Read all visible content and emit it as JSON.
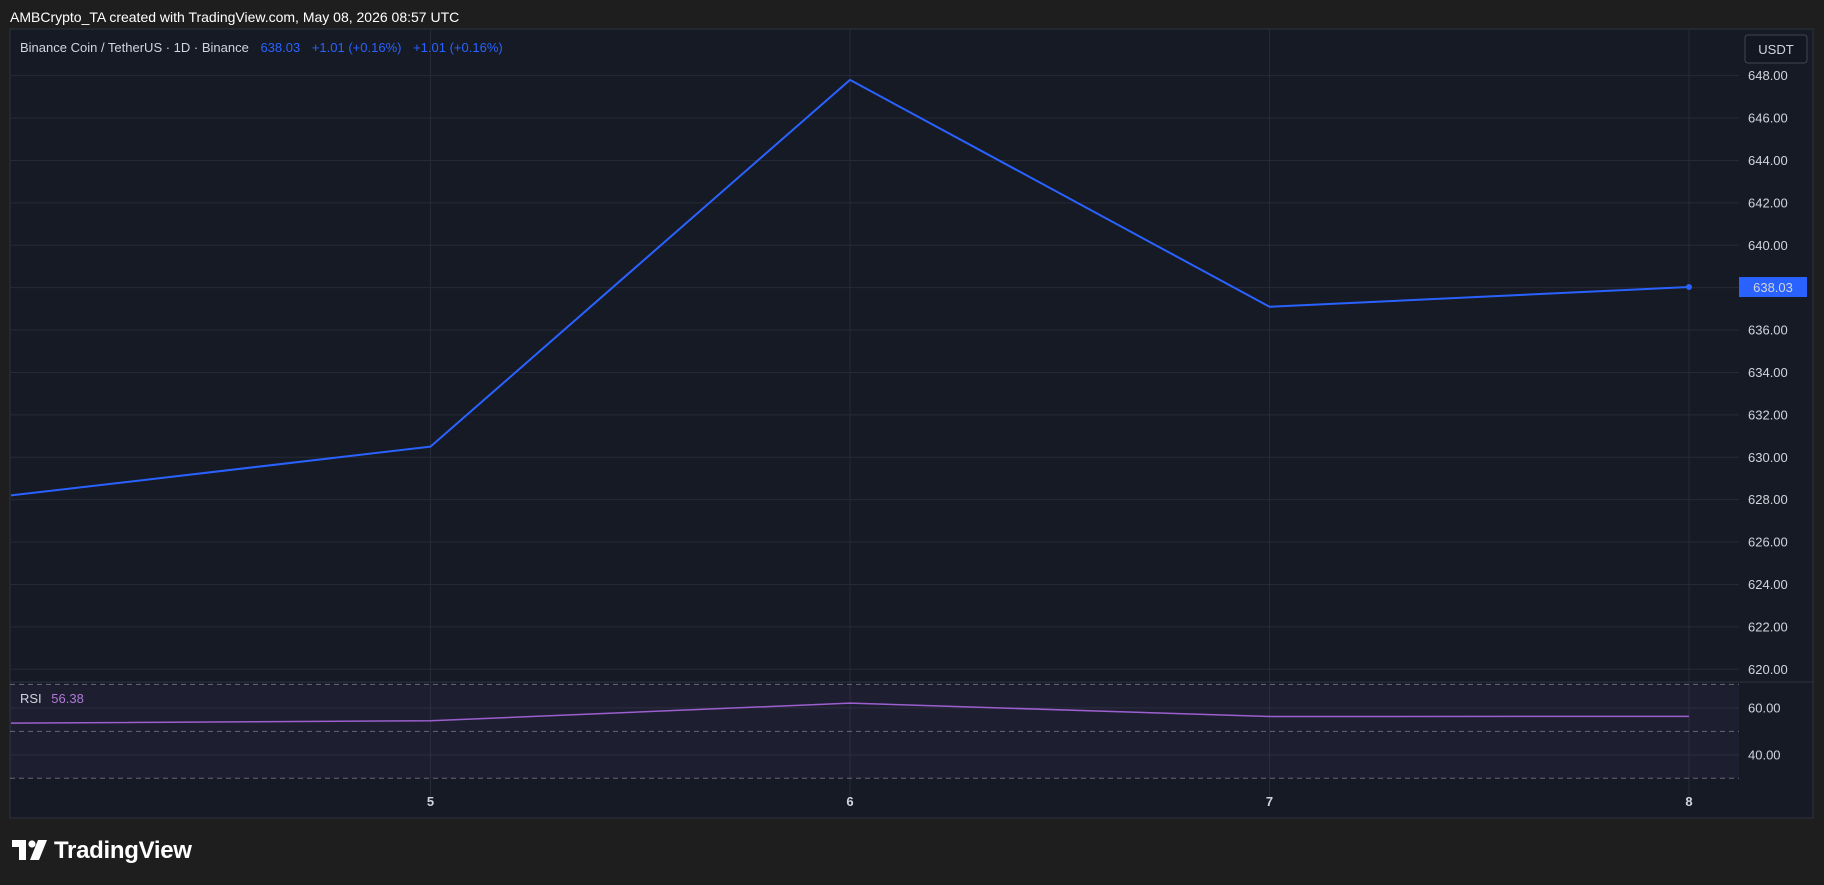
{
  "credit_text": "AMBCrypto_TA created with TradingView.com, May 08, 2026 08:57 UTC",
  "logo_text": "TradingView",
  "colors": {
    "background": "#1e1e1e",
    "chart_bg": "#161a25",
    "price_line": "#2962ff",
    "rsi_line": "#9c5fcf",
    "rsi_label": "#b07ad6",
    "grid": "#262a36",
    "text": "#d1d4dc"
  },
  "chart_data": [
    {
      "type": "line",
      "legend": {
        "symbol": "Binance Coin / TetherUS · 1D · Binance",
        "last": "638.03",
        "change1": "+1.01 (+0.16%)",
        "change2": "+1.01 (+0.16%)"
      },
      "currency_label": "USDT",
      "x": [
        "4",
        "5",
        "6",
        "7",
        "8"
      ],
      "x_tick_labels": [
        "5",
        "6",
        "7",
        "8"
      ],
      "values": [
        628.2,
        630.5,
        647.8,
        637.1,
        638.03
      ],
      "ylim": [
        619.4,
        650.2
      ],
      "y_ticks": [
        "620.00",
        "622.00",
        "624.00",
        "626.00",
        "628.00",
        "630.00",
        "632.00",
        "634.00",
        "636.00",
        "638.00",
        "640.00",
        "642.00",
        "644.00",
        "646.00",
        "648.00"
      ],
      "last_value_label": "638.03",
      "grid": true
    },
    {
      "type": "line",
      "legend": {
        "name": "RSI",
        "value": "56.38"
      },
      "x": [
        "4",
        "5",
        "6",
        "7",
        "8"
      ],
      "values": [
        53.5,
        54.5,
        62.0,
        56.3,
        56.38
      ],
      "ylim": [
        28.0,
        71.0
      ],
      "y_ticks": [
        "40.00",
        "60.00"
      ],
      "bands": [
        30,
        50,
        70
      ],
      "grid": true
    }
  ]
}
